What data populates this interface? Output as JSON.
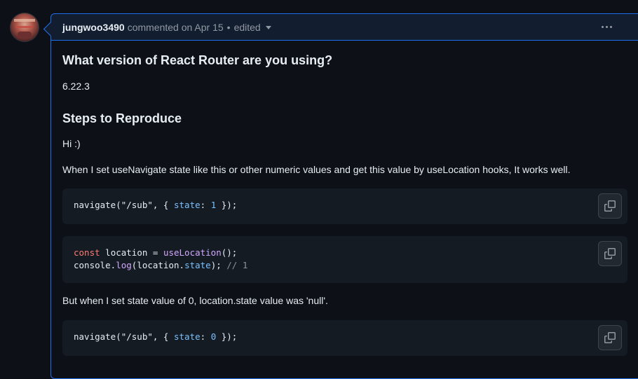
{
  "comment": {
    "author": "jungwoo3490",
    "meta": "commented on Apr 15",
    "separator": "•",
    "edited_label": "edited"
  },
  "content": {
    "heading_version": "What version of React Router are you using?",
    "version": "6.22.3",
    "heading_steps": "Steps to Reproduce",
    "greeting": "Hi :)",
    "description": "When I set useNavigate state like this or other numeric values and get this value by useLocation hooks, It works well.",
    "problem": "But when I set state value of 0, location.state value was 'null'."
  },
  "code_blocks": [
    {
      "line1": {
        "a": "navigate(\"/sub\", { ",
        "b": "state",
        "c": ": ",
        "d": "1",
        "e": " });"
      }
    },
    {
      "line1": {
        "a": "const",
        "b": " location = ",
        "c": "useLocation",
        "d": "();"
      },
      "line2": {
        "a": "console.",
        "b": "log",
        "c": "(location.",
        "d": "state",
        "e": "); ",
        "f": "// 1"
      }
    },
    {
      "line1": {
        "a": "navigate(\"/sub\", { ",
        "b": "state",
        "c": ": ",
        "d": "0",
        "e": " });"
      }
    }
  ],
  "icons": {
    "copy": "copy-icon",
    "more": "kebab-horizontal-icon",
    "caret": "triangle-down-icon"
  },
  "colors": {
    "border_accent": "#1f6feb",
    "header_bg": "#121d2f",
    "page_bg": "#0d1117",
    "code_bg": "#151b23"
  }
}
